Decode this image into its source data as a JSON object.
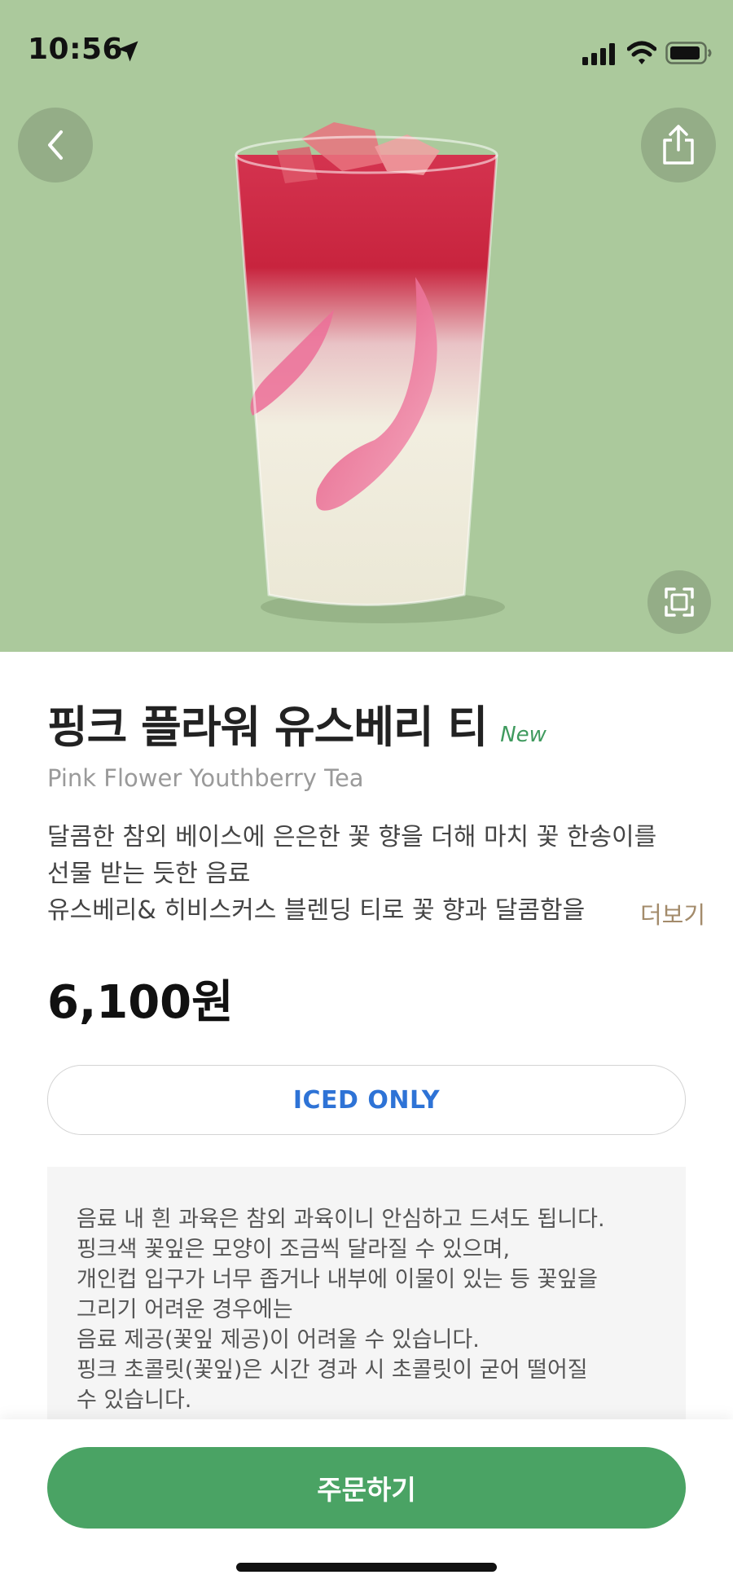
{
  "status_bar": {
    "time": "10:56"
  },
  "product": {
    "name_ko": "핑크 플라워 유스베리 티",
    "badge": "New",
    "name_en": "Pink Flower Youthberry Tea",
    "description_lines": [
      "달콤한 참외 베이스에 은은한 꽃 향을 더해 마치 꽃 한송이를",
      "선물 받는 듯한 음료",
      "유스베리& 히비스커스 블렌딩 티로 꽃 향과 달콤함을"
    ],
    "more_label": "더보기",
    "price": "6,100원",
    "temperature": "ICED ONLY"
  },
  "notice": {
    "lines": [
      "음료 내 흰 과육은 참외 과육이니 안심하고 드셔도 됩니다.",
      "핑크색 꽃잎은 모양이 조금씩 달라질 수 있으며,",
      "개인컵 입구가 너무 좁거나 내부에 이물이 있는 등 꽃잎을",
      "그리기 어려운 경우에는",
      "음료 제공(꽃잎 제공)이 어려울 수 있습니다.",
      "핑크 초콜릿(꽃잎)은 시간 경과 시 초콜릿이 굳어 떨어질",
      "수 있습니다."
    ]
  },
  "actions": {
    "order_label": "주문하기"
  },
  "icons": {
    "back": "chevron-left-icon",
    "share": "share-icon",
    "expand": "fullscreen-icon",
    "location": "location-arrow-icon",
    "signal": "cellular-signal-icon",
    "wifi": "wifi-icon",
    "battery": "battery-icon"
  },
  "colors": {
    "hero_background": "#abc99c",
    "primary_green": "#4aa364",
    "new_badge": "#3f9a5e",
    "temperature_text": "#2e73d6",
    "more_link": "#a38b6b"
  }
}
